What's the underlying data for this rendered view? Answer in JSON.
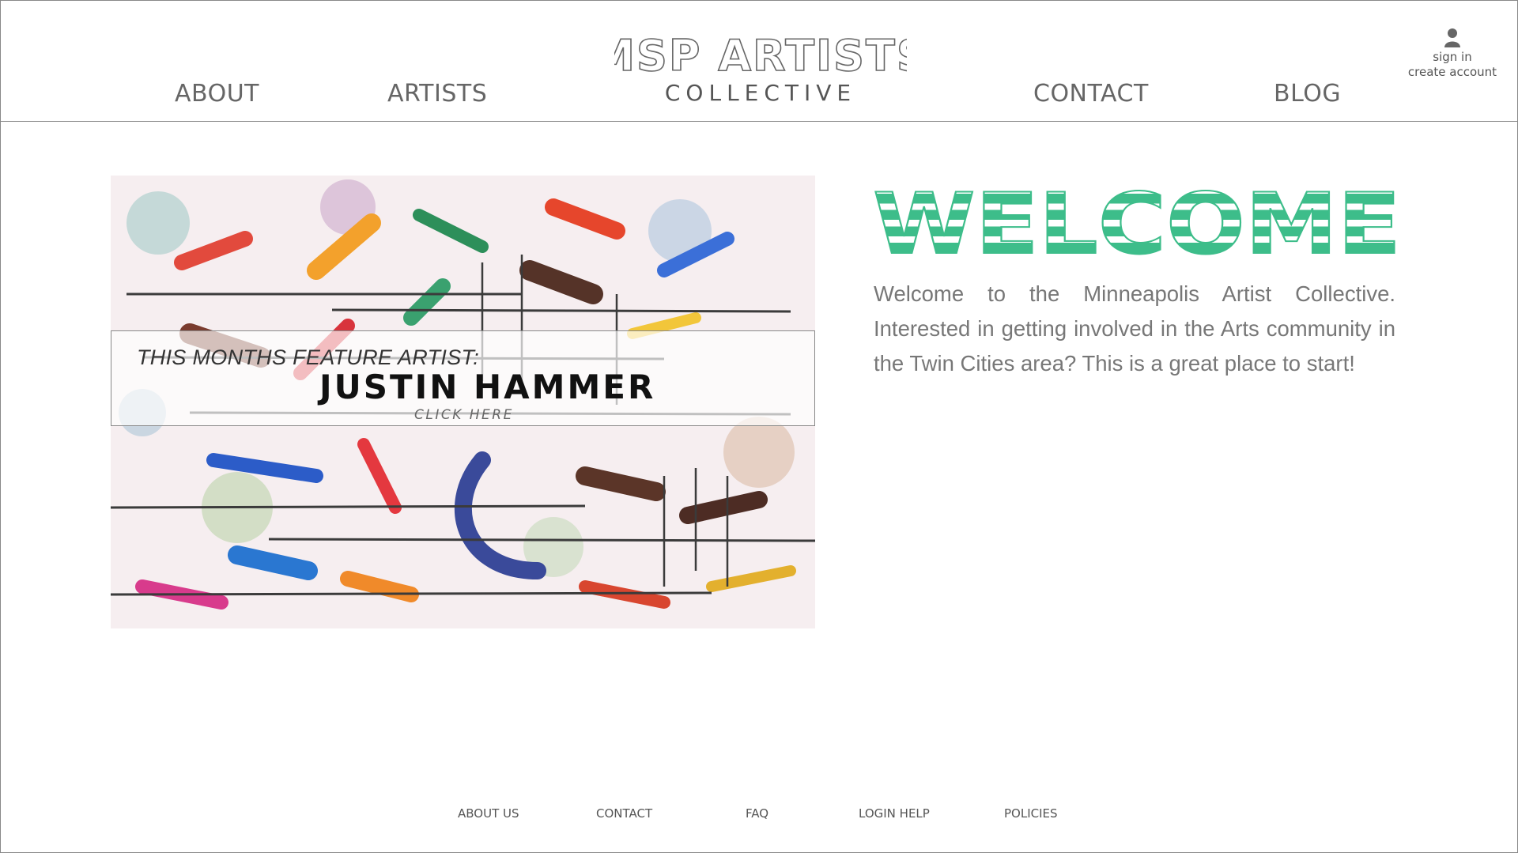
{
  "header": {
    "nav_left": [
      {
        "label": "ABOUT"
      },
      {
        "label": "ARTISTS"
      }
    ],
    "nav_right": [
      {
        "label": "CONTACT"
      },
      {
        "label": "BLOG"
      }
    ],
    "logo": {
      "title": "MSP ARTISTS",
      "subtitle": "COLLECTIVE"
    },
    "account": {
      "icon": "user-icon",
      "sign_in": "sign in",
      "create_account": "create account"
    }
  },
  "feature": {
    "label": "THIS MONTHS FEATURE ARTIST:",
    "artist_name": "JUSTIN HAMMER",
    "cta": "CLICK HERE"
  },
  "welcome": {
    "heading": "WELCOME",
    "heading_color": "#3dbd8a",
    "body": "Welcome to the Minneapolis Artist Collective. Interested in getting involved in the Arts community in the Twin Cities area? This is a great place to start!"
  },
  "footer": {
    "links": [
      {
        "label": "ABOUT US"
      },
      {
        "label": "CONTACT"
      },
      {
        "label": "FAQ"
      },
      {
        "label": "LOGIN HELP"
      },
      {
        "label": "POLICIES"
      }
    ]
  }
}
